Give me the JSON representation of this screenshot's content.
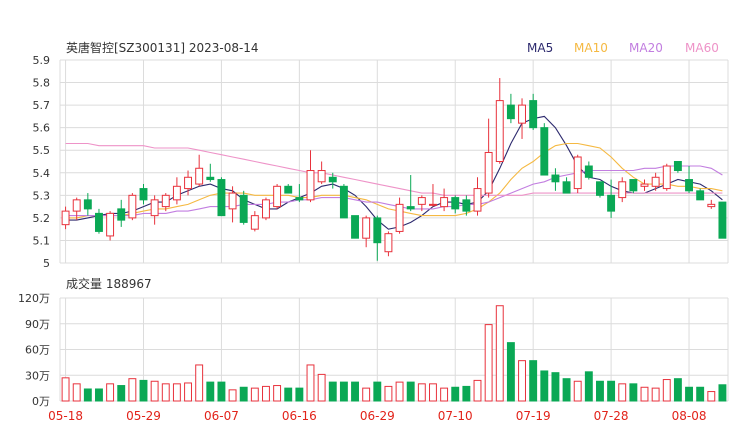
{
  "title": "英唐智控[SZ300131] 2023-08-14",
  "volume_title": "成交量 188967",
  "legend": [
    {
      "label": "MA5",
      "color": "#2d2a6e"
    },
    {
      "label": "MA10",
      "color": "#f5b942"
    },
    {
      "label": "MA20",
      "color": "#c27ee0"
    },
    {
      "label": "MA60",
      "color": "#ee93c8"
    }
  ],
  "colors": {
    "up": "#e8323c",
    "down": "#0aa855",
    "grid": "#dcdcdc",
    "axis": "#333333"
  },
  "chart_data": [
    {
      "type": "candlestick",
      "price_axis": {
        "ticks": [
          "5.9",
          "5.8",
          "5.7",
          "5.6",
          "5.5",
          "5.4",
          "5.3",
          "5.2",
          "5.1",
          "5"
        ],
        "ylim": [
          5.0,
          5.9
        ]
      },
      "date_labels": [
        "05-18",
        "05-29",
        "06-07",
        "06-16",
        "06-29",
        "07-10",
        "07-19",
        "07-28",
        "08-08"
      ],
      "date_label_index": [
        0,
        7,
        14,
        21,
        28,
        35,
        42,
        49,
        56
      ],
      "candles": [
        {
          "o": 5.17,
          "h": 5.25,
          "l": 5.15,
          "c": 5.23
        },
        {
          "o": 5.23,
          "h": 5.29,
          "l": 5.19,
          "c": 5.28
        },
        {
          "o": 5.28,
          "h": 5.31,
          "l": 5.21,
          "c": 5.24
        },
        {
          "o": 5.22,
          "h": 5.24,
          "l": 5.13,
          "c": 5.14
        },
        {
          "o": 5.12,
          "h": 5.23,
          "l": 5.1,
          "c": 5.22
        },
        {
          "o": 5.24,
          "h": 5.28,
          "l": 5.16,
          "c": 5.19
        },
        {
          "o": 5.2,
          "h": 5.31,
          "l": 5.19,
          "c": 5.3
        },
        {
          "o": 5.33,
          "h": 5.35,
          "l": 5.26,
          "c": 5.28
        },
        {
          "o": 5.21,
          "h": 5.3,
          "l": 5.17,
          "c": 5.28
        },
        {
          "o": 5.25,
          "h": 5.31,
          "l": 5.23,
          "c": 5.3
        },
        {
          "o": 5.28,
          "h": 5.38,
          "l": 5.26,
          "c": 5.34
        },
        {
          "o": 5.33,
          "h": 5.41,
          "l": 5.3,
          "c": 5.38
        },
        {
          "o": 5.35,
          "h": 5.48,
          "l": 5.34,
          "c": 5.42
        },
        {
          "o": 5.38,
          "h": 5.44,
          "l": 5.36,
          "c": 5.37
        },
        {
          "o": 5.37,
          "h": 5.38,
          "l": 5.21,
          "c": 5.21
        },
        {
          "o": 5.24,
          "h": 5.34,
          "l": 5.18,
          "c": 5.31
        },
        {
          "o": 5.3,
          "h": 5.32,
          "l": 5.17,
          "c": 5.18
        },
        {
          "o": 5.15,
          "h": 5.23,
          "l": 5.14,
          "c": 5.21
        },
        {
          "o": 5.2,
          "h": 5.29,
          "l": 5.19,
          "c": 5.28
        },
        {
          "o": 5.25,
          "h": 5.35,
          "l": 5.24,
          "c": 5.34
        },
        {
          "o": 5.34,
          "h": 5.35,
          "l": 5.31,
          "c": 5.31
        },
        {
          "o": 5.29,
          "h": 5.35,
          "l": 5.27,
          "c": 5.28
        },
        {
          "o": 5.28,
          "h": 5.5,
          "l": 5.27,
          "c": 5.41
        },
        {
          "o": 5.36,
          "h": 5.45,
          "l": 5.35,
          "c": 5.41
        },
        {
          "o": 5.38,
          "h": 5.4,
          "l": 5.33,
          "c": 5.36
        },
        {
          "o": 5.34,
          "h": 5.35,
          "l": 5.2,
          "c": 5.2
        },
        {
          "o": 5.21,
          "h": 5.21,
          "l": 5.11,
          "c": 5.11
        },
        {
          "o": 5.11,
          "h": 5.21,
          "l": 5.07,
          "c": 5.2
        },
        {
          "o": 5.2,
          "h": 5.21,
          "l": 5.01,
          "c": 5.09
        },
        {
          "o": 5.05,
          "h": 5.14,
          "l": 5.03,
          "c": 5.13
        },
        {
          "o": 5.14,
          "h": 5.29,
          "l": 5.13,
          "c": 5.26
        },
        {
          "o": 5.25,
          "h": 5.39,
          "l": 5.23,
          "c": 5.24
        },
        {
          "o": 5.26,
          "h": 5.3,
          "l": 5.23,
          "c": 5.29
        },
        {
          "o": 5.26,
          "h": 5.35,
          "l": 5.25,
          "c": 5.26
        },
        {
          "o": 5.25,
          "h": 5.33,
          "l": 5.23,
          "c": 5.29
        },
        {
          "o": 5.29,
          "h": 5.3,
          "l": 5.22,
          "c": 5.24
        },
        {
          "o": 5.28,
          "h": 5.3,
          "l": 5.21,
          "c": 5.23
        },
        {
          "o": 5.23,
          "h": 5.38,
          "l": 5.21,
          "c": 5.33
        },
        {
          "o": 5.31,
          "h": 5.64,
          "l": 5.29,
          "c": 5.49
        },
        {
          "o": 5.45,
          "h": 5.82,
          "l": 5.44,
          "c": 5.72
        },
        {
          "o": 5.7,
          "h": 5.75,
          "l": 5.62,
          "c": 5.64
        },
        {
          "o": 5.62,
          "h": 5.73,
          "l": 5.55,
          "c": 5.7
        },
        {
          "o": 5.72,
          "h": 5.75,
          "l": 5.59,
          "c": 5.6
        },
        {
          "o": 5.6,
          "h": 5.62,
          "l": 5.39,
          "c": 5.39
        },
        {
          "o": 5.39,
          "h": 5.42,
          "l": 5.32,
          "c": 5.36
        },
        {
          "o": 5.36,
          "h": 5.38,
          "l": 5.31,
          "c": 5.31
        },
        {
          "o": 5.33,
          "h": 5.48,
          "l": 5.31,
          "c": 5.47
        },
        {
          "o": 5.43,
          "h": 5.45,
          "l": 5.37,
          "c": 5.38
        },
        {
          "o": 5.36,
          "h": 5.36,
          "l": 5.29,
          "c": 5.3
        },
        {
          "o": 5.3,
          "h": 5.37,
          "l": 5.2,
          "c": 5.23
        },
        {
          "o": 5.29,
          "h": 5.38,
          "l": 5.27,
          "c": 5.36
        },
        {
          "o": 5.37,
          "h": 5.37,
          "l": 5.31,
          "c": 5.32
        },
        {
          "o": 5.34,
          "h": 5.37,
          "l": 5.32,
          "c": 5.35
        },
        {
          "o": 5.34,
          "h": 5.4,
          "l": 5.32,
          "c": 5.38
        },
        {
          "o": 5.33,
          "h": 5.44,
          "l": 5.32,
          "c": 5.43
        },
        {
          "o": 5.45,
          "h": 5.45,
          "l": 5.4,
          "c": 5.41
        },
        {
          "o": 5.37,
          "h": 5.43,
          "l": 5.31,
          "c": 5.32
        },
        {
          "o": 5.32,
          "h": 5.33,
          "l": 5.28,
          "c": 5.28
        },
        {
          "o": 5.25,
          "h": 5.28,
          "l": 5.24,
          "c": 5.26
        },
        {
          "o": 5.27,
          "h": 5.27,
          "l": 5.11,
          "c": 5.11
        }
      ],
      "ma_series": [
        {
          "name": "MA5",
          "values": [
            5.19,
            5.19,
            5.2,
            5.21,
            5.22,
            5.22,
            5.23,
            5.25,
            5.27,
            5.27,
            5.3,
            5.32,
            5.34,
            5.35,
            5.33,
            5.32,
            5.28,
            5.26,
            5.24,
            5.24,
            5.27,
            5.29,
            5.31,
            5.34,
            5.35,
            5.33,
            5.3,
            5.25,
            5.19,
            5.15,
            5.16,
            5.18,
            5.21,
            5.25,
            5.27,
            5.27,
            5.26,
            5.27,
            5.32,
            5.42,
            5.53,
            5.62,
            5.64,
            5.65,
            5.6,
            5.52,
            5.43,
            5.38,
            5.37,
            5.34,
            5.32,
            5.31,
            5.31,
            5.33,
            5.35,
            5.37,
            5.36,
            5.35,
            5.32,
            5.28
          ]
        },
        {
          "name": "MA10",
          "values": [
            5.2,
            5.2,
            5.21,
            5.21,
            5.21,
            5.21,
            5.22,
            5.23,
            5.24,
            5.24,
            5.25,
            5.26,
            5.28,
            5.3,
            5.31,
            5.31,
            5.31,
            5.3,
            5.3,
            5.3,
            5.3,
            5.29,
            5.29,
            5.3,
            5.3,
            5.3,
            5.29,
            5.28,
            5.26,
            5.24,
            5.23,
            5.22,
            5.21,
            5.21,
            5.21,
            5.21,
            5.22,
            5.24,
            5.27,
            5.31,
            5.37,
            5.42,
            5.45,
            5.49,
            5.52,
            5.53,
            5.53,
            5.52,
            5.51,
            5.47,
            5.42,
            5.38,
            5.35,
            5.35,
            5.35,
            5.34,
            5.34,
            5.33,
            5.33,
            5.32
          ]
        },
        {
          "name": "MA20",
          "values": [
            5.21,
            5.21,
            5.21,
            5.21,
            5.21,
            5.21,
            5.21,
            5.22,
            5.22,
            5.22,
            5.23,
            5.23,
            5.24,
            5.25,
            5.25,
            5.25,
            5.26,
            5.26,
            5.26,
            5.27,
            5.27,
            5.28,
            5.28,
            5.29,
            5.29,
            5.29,
            5.28,
            5.27,
            5.27,
            5.26,
            5.25,
            5.24,
            5.24,
            5.24,
            5.25,
            5.25,
            5.26,
            5.26,
            5.27,
            5.29,
            5.31,
            5.33,
            5.35,
            5.36,
            5.38,
            5.39,
            5.4,
            5.41,
            5.41,
            5.41,
            5.41,
            5.41,
            5.42,
            5.42,
            5.43,
            5.43,
            5.43,
            5.43,
            5.42,
            5.39
          ]
        },
        {
          "name": "MA60",
          "values": [
            5.53,
            5.53,
            5.53,
            5.52,
            5.52,
            5.52,
            5.52,
            5.52,
            5.51,
            5.51,
            5.51,
            5.51,
            5.5,
            5.49,
            5.48,
            5.47,
            5.46,
            5.45,
            5.44,
            5.43,
            5.42,
            5.41,
            5.4,
            5.4,
            5.39,
            5.38,
            5.37,
            5.36,
            5.35,
            5.34,
            5.33,
            5.32,
            5.31,
            5.31,
            5.3,
            5.3,
            5.3,
            5.3,
            5.3,
            5.3,
            5.3,
            5.3,
            5.31,
            5.31,
            5.31,
            5.31,
            5.31,
            5.31,
            5.31,
            5.31,
            5.31,
            5.31,
            5.31,
            5.31,
            5.31,
            5.31,
            5.31,
            5.31,
            5.31,
            5.31
          ]
        }
      ]
    },
    {
      "type": "bar",
      "title": "成交量 188967",
      "volume_axis": {
        "ticks": [
          "120万",
          "90万",
          "60万",
          "30万",
          "0万"
        ],
        "ylim": [
          0,
          1200000
        ]
      },
      "volume": [
        270000,
        200000,
        140000,
        140000,
        200000,
        180000,
        260000,
        240000,
        230000,
        200000,
        200000,
        210000,
        420000,
        220000,
        220000,
        130000,
        160000,
        150000,
        170000,
        180000,
        150000,
        150000,
        420000,
        310000,
        220000,
        220000,
        220000,
        150000,
        220000,
        170000,
        220000,
        220000,
        200000,
        200000,
        150000,
        160000,
        170000,
        240000,
        890000,
        1110000,
        680000,
        470000,
        470000,
        350000,
        330000,
        260000,
        230000,
        340000,
        230000,
        230000,
        200000,
        200000,
        160000,
        150000,
        250000,
        260000,
        160000,
        160000,
        110000,
        188967
      ]
    }
  ]
}
